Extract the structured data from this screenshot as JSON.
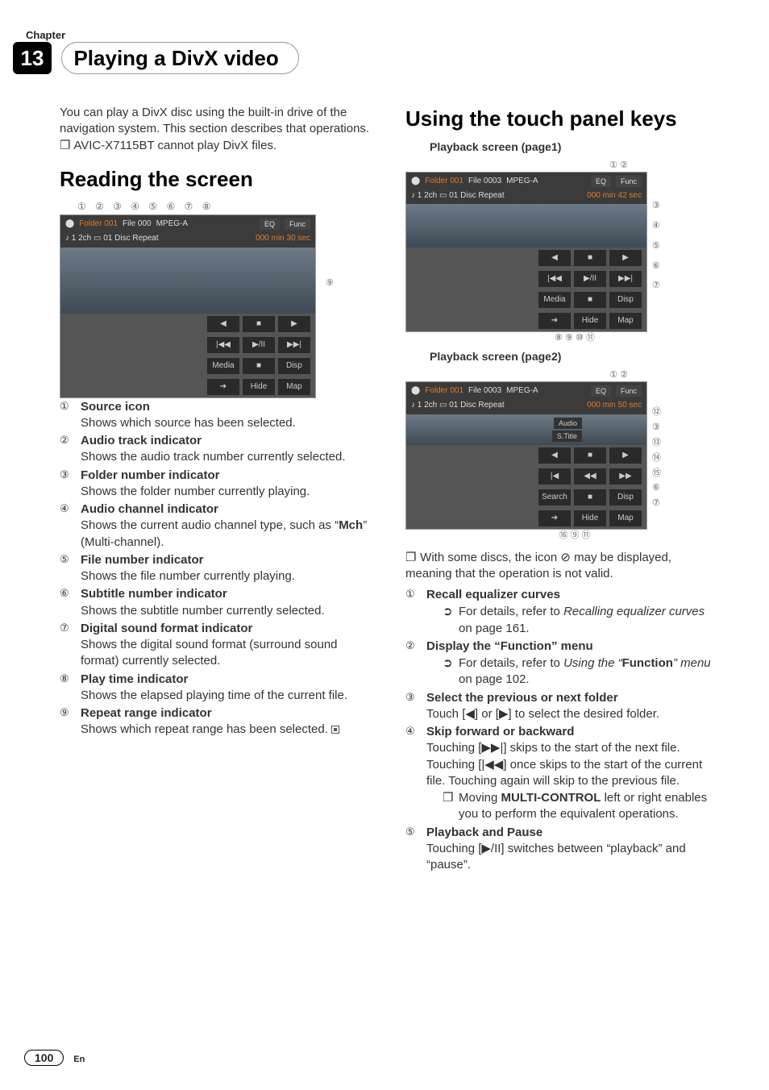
{
  "chapter": {
    "label": "Chapter",
    "number": "13",
    "title": "Playing a DivX video"
  },
  "left": {
    "intro": "You can play a DivX disc using the built-in drive of the navigation system. This section describes that operations.",
    "note": "AVIC-X7115BT cannot play DivX files.",
    "h2": "Reading the screen",
    "callout_row": "① ② ③    ④ ⑤    ⑥  ⑦      ⑧",
    "mock": {
      "folder": "Folder 001",
      "file": "File  000",
      "codec": "MPEG-A",
      "sub": "♪ 1     2ch   ▭ 01   Disc Repeat",
      "eq": "EQ",
      "func": "Func",
      "time": "000 min 30 sec",
      "right_num": "⑨",
      "row1": [
        "◀",
        "■",
        "▶"
      ],
      "row2": [
        "|◀◀",
        "▶/II",
        "▶▶|"
      ],
      "row3": [
        "Media",
        "■",
        "Disp"
      ],
      "row4": [
        "➔",
        "Hide",
        "Map"
      ]
    },
    "items": [
      {
        "n": "①",
        "t": "Source icon",
        "d": "Shows which source has been selected."
      },
      {
        "n": "②",
        "t": "Audio track indicator",
        "d": "Shows the audio track number currently selected."
      },
      {
        "n": "③",
        "t": "Folder number indicator",
        "d": "Shows the folder number currently playing."
      },
      {
        "n": "④",
        "t": "Audio channel indicator",
        "d": "Shows the current audio channel type, such as “",
        "bold": "Mch",
        "d2": "” (Multi-channel)."
      },
      {
        "n": "⑤",
        "t": "File number indicator",
        "d": "Shows the file number currently playing."
      },
      {
        "n": "⑥",
        "t": "Subtitle number indicator",
        "d": "Shows the subtitle number currently selected."
      },
      {
        "n": "⑦",
        "t": "Digital sound format indicator",
        "d": "Shows the digital sound format (surround sound format) currently selected."
      },
      {
        "n": "⑧",
        "t": "Play time indicator",
        "d": "Shows the elapsed playing time of the current file."
      },
      {
        "n": "⑨",
        "t": "Repeat range indicator",
        "d": "Shows which repeat range has been selected."
      }
    ]
  },
  "right": {
    "h2": "Using the touch panel keys",
    "p1_label": "Playback screen (page1)",
    "p2_label": "Playback screen (page2)",
    "mock1": {
      "folder": "Folder 001",
      "file": "File  0003",
      "codec": "MPEG-A",
      "sub": "♪ 1     2ch   ▭ 01   Disc Repeat",
      "eq": "EQ",
      "func": "Func",
      "time": "000 min 42 sec",
      "top_nums": "①      ②",
      "side_nums": [
        "③",
        "④",
        "⑤",
        "⑥",
        "⑦"
      ],
      "bottom_nums": "⑧  ⑨  ⑩  ⑪"
    },
    "mock2": {
      "folder": "Folder 001",
      "file": "File  0003",
      "codec": "MPEG-A",
      "sub": "♪ 1     2ch   ▭ 01   Disc Repeat",
      "eq": "EQ",
      "func": "Func",
      "time": "000 min 50 sec",
      "top_nums": "①      ②",
      "lbl_audio": "Audio",
      "lbl_stitle": "S.Title",
      "lbl_search": "Search",
      "side_nums": [
        "⑫",
        "③",
        "⑬",
        "⑭",
        "⑮",
        "⑥",
        "⑦"
      ],
      "bottom_nums": "⑯   ⑨      ⑪"
    },
    "note": "With some discs, the icon  ⊘  may be displayed, meaning that the operation is not valid.",
    "items": [
      {
        "n": "①",
        "t": "Recall equalizer curves",
        "arrow": true,
        "d": "For details, refer to ",
        "i": "Recalling equalizer curves",
        "d2": " on page 161."
      },
      {
        "n": "②",
        "t": "Display the “Function” menu",
        "arrow": true,
        "d": "For details, refer to ",
        "i": "Using the ",
        "q": "“",
        "b": "Function",
        "q2": "”",
        "i2": " menu",
        "d2": " on page 102."
      },
      {
        "n": "③",
        "t": "Select the previous or next folder",
        "d": "Touch [◀] or [▶] to select the desired folder."
      },
      {
        "n": "④",
        "t": "Skip forward or backward",
        "d": "Touching [▶▶|] skips to the start of the next file. Touching [|◀◀] once skips to the start of the current file. Touching again will skip to the previous file.",
        "bullet": true,
        "bd": "Moving ",
        "bbold": "MULTI-CONTROL",
        "bd2": " left or right enables you to perform the equivalent operations."
      },
      {
        "n": "⑤",
        "t": "Playback and Pause",
        "d": "Touching [▶/II] switches between “playback” and “pause”."
      }
    ]
  },
  "footer": {
    "page": "100",
    "lang": "En"
  }
}
